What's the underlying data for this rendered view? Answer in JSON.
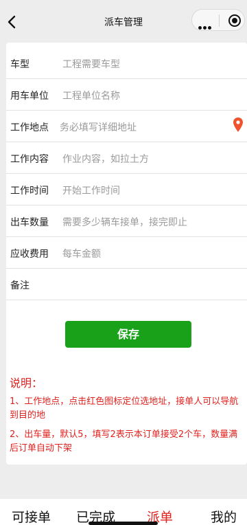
{
  "navbar": {
    "title": "派车管理"
  },
  "form": {
    "fields": [
      {
        "label": "车型",
        "placeholder": "工程需要车型"
      },
      {
        "label": "用车单位",
        "placeholder": "工程单位名称"
      },
      {
        "label": "工作地点",
        "placeholder": "务必填写详细地址"
      },
      {
        "label": "工作内容",
        "placeholder": "作业内容，如拉土方"
      },
      {
        "label": "工作时间",
        "placeholder": "开始工作时间"
      },
      {
        "label": "出车数量",
        "placeholder": "需要多少辆车接单，接完即止"
      },
      {
        "label": "应收费用",
        "placeholder": "每车金额"
      },
      {
        "label": "备注",
        "placeholder": ""
      }
    ],
    "save_label": "保存"
  },
  "notes": {
    "title": "说明：",
    "items": [
      "1、工作地点，点击红色图标定位选地址，接单人可以导航到目的地",
      "2、出车量，默认5，填写2表示本订单接受2个车，数量满后订单自动下架"
    ]
  },
  "tabbar": {
    "tabs": [
      {
        "label": "可接单"
      },
      {
        "label": "已完成"
      },
      {
        "label": "派单"
      },
      {
        "label": "我的"
      }
    ],
    "active_color": "#e0221f"
  },
  "colors": {
    "accent": "#1aa11a",
    "warning": "#e0221f"
  }
}
